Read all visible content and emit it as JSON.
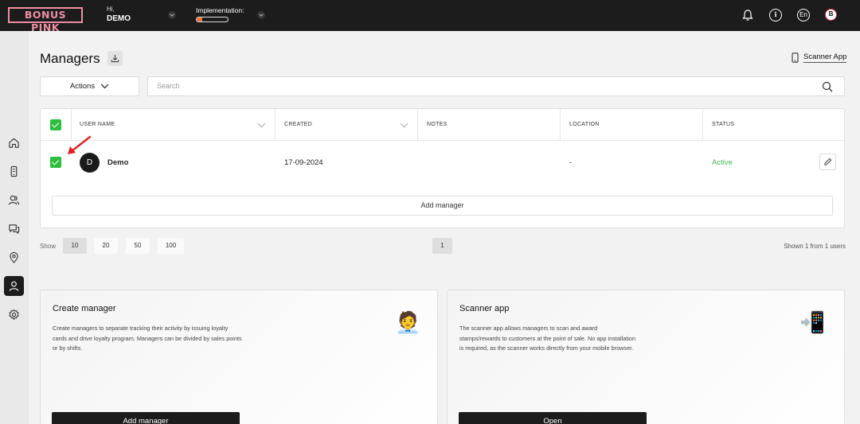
{
  "brand": {
    "logo_text": "BONUS PINK",
    "accent": "#ec8fa1"
  },
  "header": {
    "greeting": "Hi,",
    "user_name": "DEMO",
    "implementation_label": "Implementation:",
    "implementation_progress": 0.18,
    "language": "En",
    "avatar_initial": "B",
    "icons": [
      "bell-icon",
      "info-icon",
      "language-button",
      "avatar"
    ]
  },
  "sidebar": {
    "items": [
      {
        "name": "home",
        "icon": "home-icon",
        "active": false
      },
      {
        "name": "devices",
        "icon": "phone-icon",
        "active": false
      },
      {
        "name": "customers",
        "icon": "users-icon",
        "active": false
      },
      {
        "name": "messages",
        "icon": "chat-icon",
        "active": false
      },
      {
        "name": "locations",
        "icon": "location-pin-icon",
        "active": false
      },
      {
        "name": "managers",
        "icon": "manager-icon",
        "active": true
      },
      {
        "name": "settings",
        "icon": "gear-icon",
        "active": false
      }
    ]
  },
  "page": {
    "title": "Managers",
    "scanner_app_link": "Scanner App",
    "actions_label": "Actions",
    "search_placeholder": "Search"
  },
  "table": {
    "columns": [
      "USER NAME",
      "CREATED",
      "NOTES",
      "LOCATION",
      "STATUS"
    ],
    "rows": [
      {
        "avatar": "D",
        "user_name": "Demo",
        "created": "17-09-2024",
        "notes": "",
        "location": "-",
        "status": "Active",
        "checked": true
      }
    ],
    "add_button": "Add manager"
  },
  "pagination": {
    "show_label": "Show",
    "sizes": [
      "10",
      "20",
      "50",
      "100"
    ],
    "selected_size": "10",
    "current_page": "1",
    "summary": "Shown 1 from 1 users"
  },
  "cards": [
    {
      "title": "Create manager",
      "description": "Create managers to separate tracking their activity by issuing loyalty cards and drive loyalty program. Managers can be divided by sales points or by shifts.",
      "emoji": "🧑‍💼",
      "button": "Add manager"
    },
    {
      "title": "Scanner app",
      "description": "The scanner app allows managers to scan and award stamps/rewards to customers at the point of sale. No app installation is required, as the scanner works directly from your mobile browser.",
      "emoji": "📲",
      "button": "Open"
    }
  ],
  "colors": {
    "status_active": "#44b856",
    "checkbox": "#2ebd3c",
    "topbar": "#1c1c1c",
    "progress": "#f07030",
    "annotation_arrow": "#e02020"
  }
}
